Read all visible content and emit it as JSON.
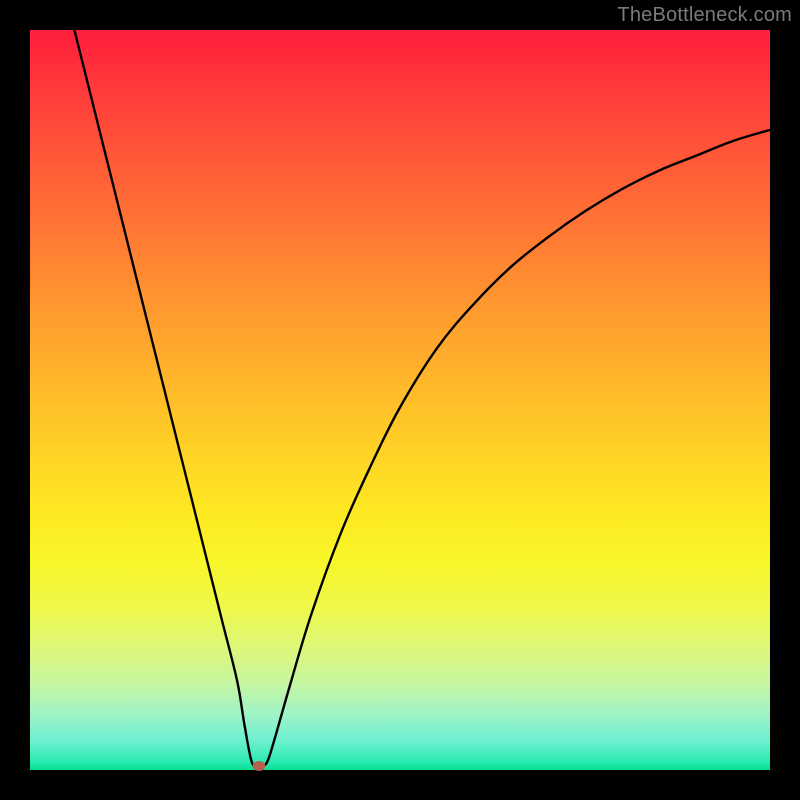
{
  "watermark": "TheBottleneck.com",
  "chart_data": {
    "type": "line",
    "title": "",
    "xlabel": "",
    "ylabel": "",
    "xlim": [
      0,
      100
    ],
    "ylim": [
      0,
      100
    ],
    "series": [
      {
        "name": "bottleneck-curve",
        "x": [
          6,
          8,
          10,
          12,
          14,
          16,
          18,
          20,
          22,
          24,
          26,
          28,
          29,
          30,
          31,
          32,
          33,
          35,
          38,
          42,
          46,
          50,
          55,
          60,
          65,
          70,
          75,
          80,
          85,
          90,
          95,
          100
        ],
        "y": [
          100,
          92,
          84,
          76,
          68,
          60,
          52,
          44,
          36,
          28,
          20,
          12,
          6,
          1,
          0.5,
          1,
          4,
          11,
          21,
          32,
          41,
          49,
          57,
          63,
          68,
          72,
          75.5,
          78.5,
          81,
          83,
          85,
          86.5
        ]
      }
    ],
    "marker": {
      "x": 31,
      "y": 0.5,
      "color": "#b4614d"
    },
    "background_gradient": {
      "top": "#ff1e3c",
      "bottom": "#03e08e"
    }
  }
}
